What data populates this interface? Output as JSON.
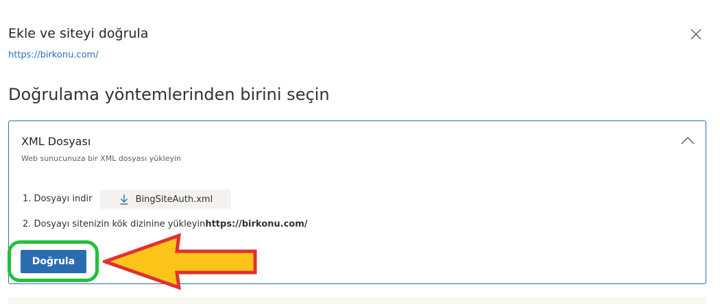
{
  "dialog": {
    "title": "Ekle ve siteyi doğrula",
    "site_url": "https://birkonu.com/",
    "close_icon": "close-icon"
  },
  "section": {
    "heading": "Doğrulama yöntemlerinden birini seçin"
  },
  "method": {
    "title": "XML Dosyası",
    "subtitle": "Web sunucunuza bir XML dosyası yükleyin",
    "collapse_icon": "chevron-up-icon",
    "step1_label": "1. Dosyayı indir",
    "download_icon": "download-icon",
    "download_label": "BingSiteAuth.xml",
    "step2_label": "2. Dosyayı sitenizin kök dizinine yükleyin",
    "step2_url": "https://birkonu.com/",
    "verify_label": "Doğrula"
  },
  "colors": {
    "accent": "#2b6cb0",
    "link": "#2a6ebb",
    "highlight_ring": "#22c03a",
    "arrow_fill": "#fcc419",
    "arrow_border": "#e03131"
  }
}
